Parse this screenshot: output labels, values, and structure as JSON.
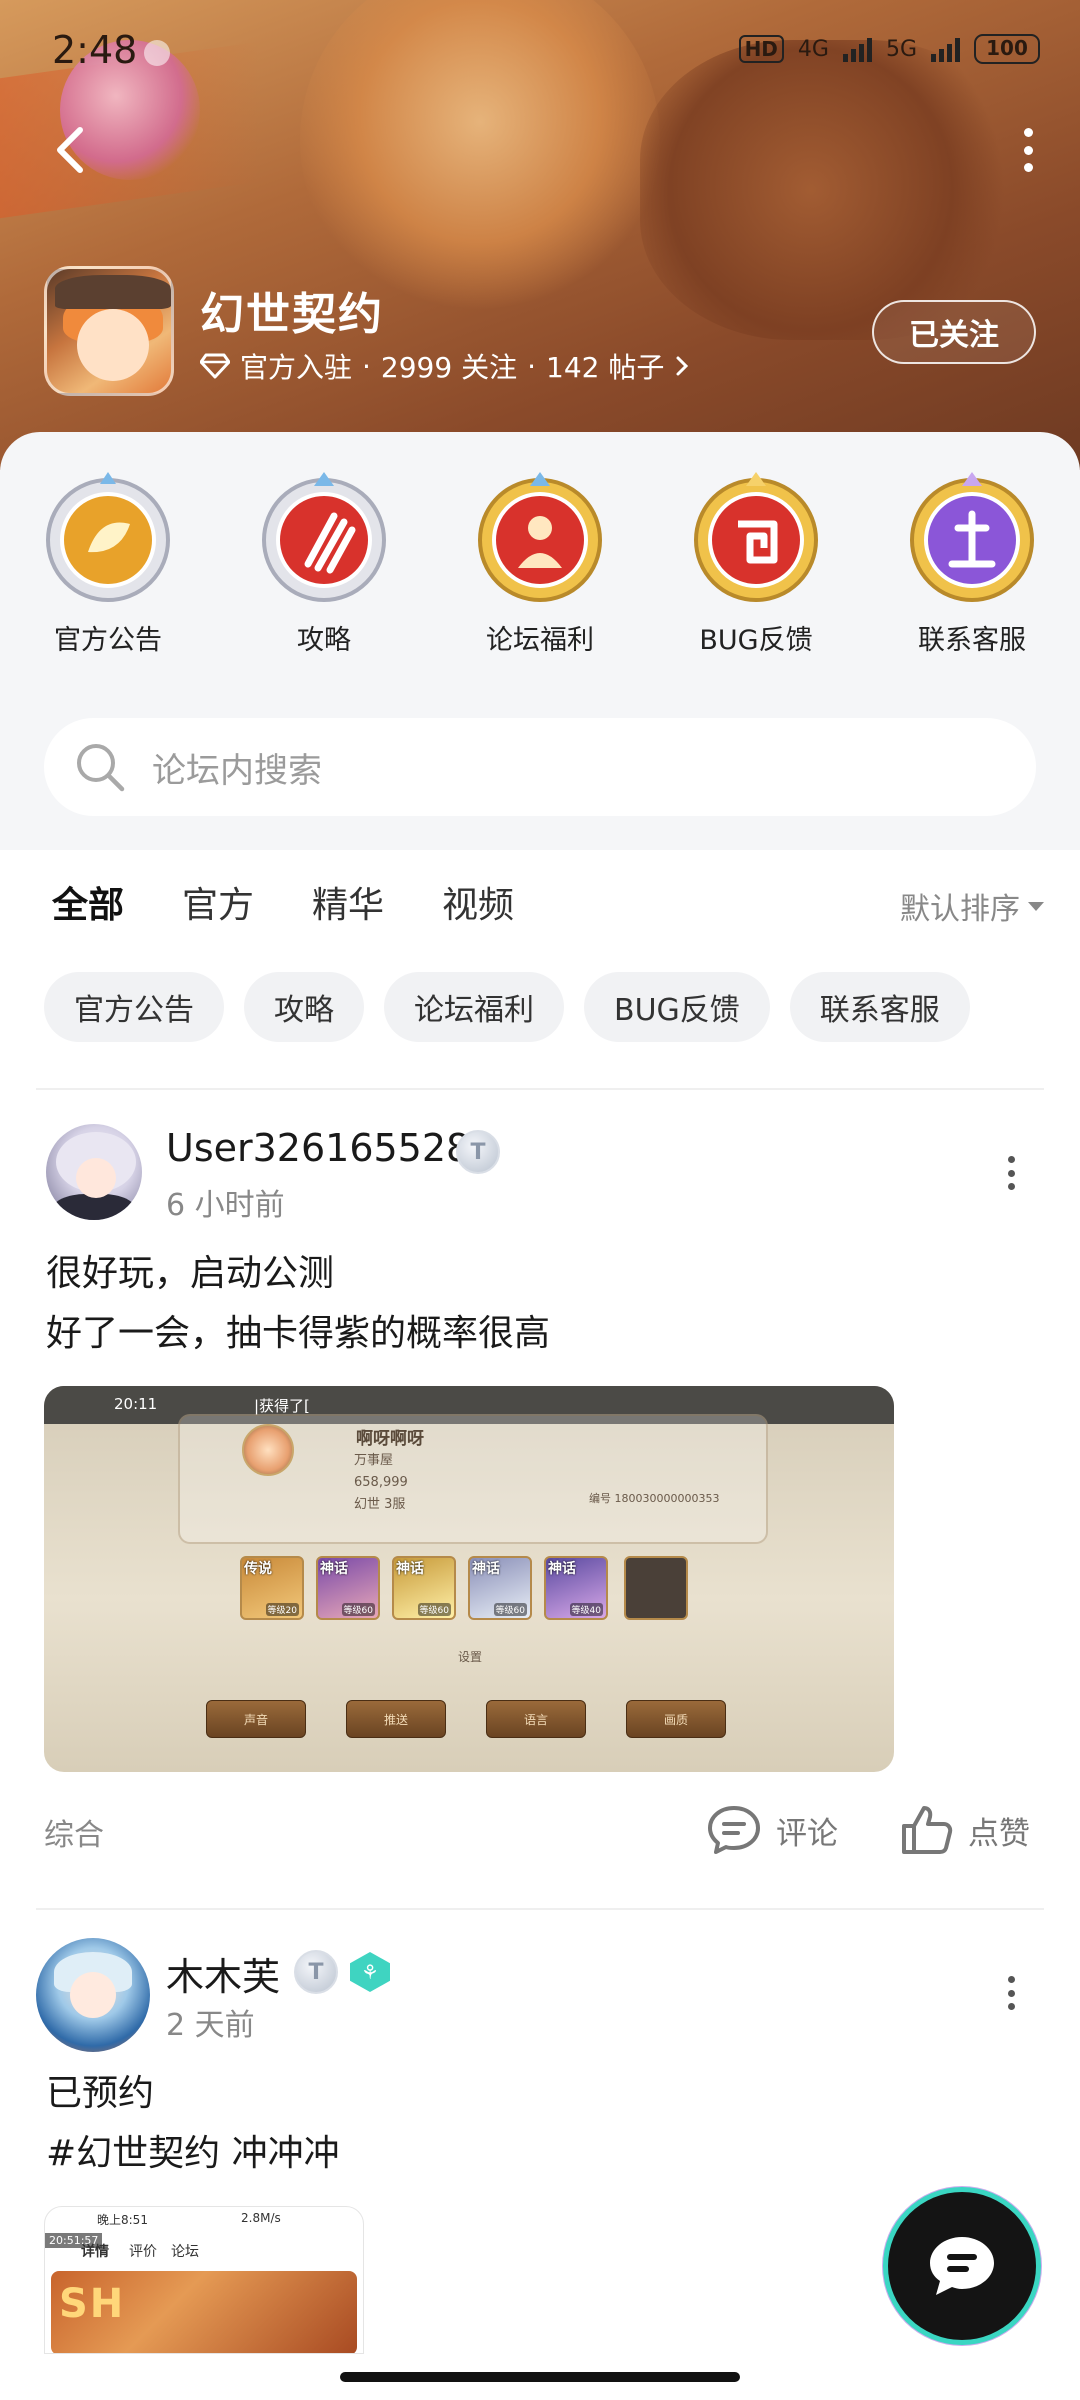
{
  "status_bar": {
    "time": "2:48",
    "hd": "HD",
    "net1": "4G",
    "net2": "5G",
    "battery": "100"
  },
  "header": {
    "forum_name": "幻世契约",
    "official_label": "官方入驻",
    "followers": "2999 关注",
    "posts": "142 帖子",
    "follow_button": "已关注"
  },
  "shortcuts": [
    {
      "label": "官方公告",
      "color": "#e8a22a"
    },
    {
      "label": "攻略",
      "color": "#d8322c"
    },
    {
      "label": "论坛福利",
      "color": "#d8322c"
    },
    {
      "label": "BUG反馈",
      "color": "#d8322c"
    },
    {
      "label": "联系客服",
      "color": "#8b56d8"
    }
  ],
  "search": {
    "placeholder": "论坛内搜索"
  },
  "tabs": [
    "全部",
    "官方",
    "精华",
    "视频"
  ],
  "sort_label": "默认排序",
  "filter_chips": [
    "官方公告",
    "攻略",
    "论坛福利",
    "BUG反馈",
    "联系客服"
  ],
  "posts": [
    {
      "user": "User326165528",
      "level": "T",
      "time": "6 小时前",
      "lines": [
        "很好玩，启动公测",
        "好了一会，抽卡得紫的概率很高"
      ],
      "screenshot": {
        "time": "20:11",
        "got_text": "|获得了[",
        "player_name": "啊呀啊呀",
        "guild": "万事屋",
        "power": "658,999",
        "server": "幻世 3服",
        "id_text": "编号 180030000000353",
        "heroes": [
          {
            "tag": "传说",
            "lvl": "等级20",
            "color": "#c98a3a"
          },
          {
            "tag": "神话",
            "lvl": "等级60",
            "color": "#7a4aa8"
          },
          {
            "tag": "神话",
            "lvl": "等级60",
            "color": "#c79a3a"
          },
          {
            "tag": "神话",
            "lvl": "等级60",
            "color": "#8a8fb8"
          },
          {
            "tag": "神话",
            "lvl": "等级40",
            "color": "#5a4aa0"
          }
        ],
        "settings_label": "设置",
        "buttons": [
          "声音",
          "推送",
          "语言",
          "画质"
        ]
      },
      "category": "综合",
      "comment_label": "评论",
      "like_label": "点赞"
    },
    {
      "user": "木木芙",
      "level": "T",
      "time": "2 天前",
      "lines": [
        "已预约",
        "#幻世契约 冲冲冲"
      ],
      "screenshot": {
        "status": "晚上8:51",
        "speed": "2.8M/s",
        "timestamp": "20:51:57",
        "nav_detail": "详情",
        "nav_review": "评价",
        "nav_forum": "论坛",
        "banner_text": "SH"
      }
    }
  ],
  "accent_color": "#34c5b3"
}
